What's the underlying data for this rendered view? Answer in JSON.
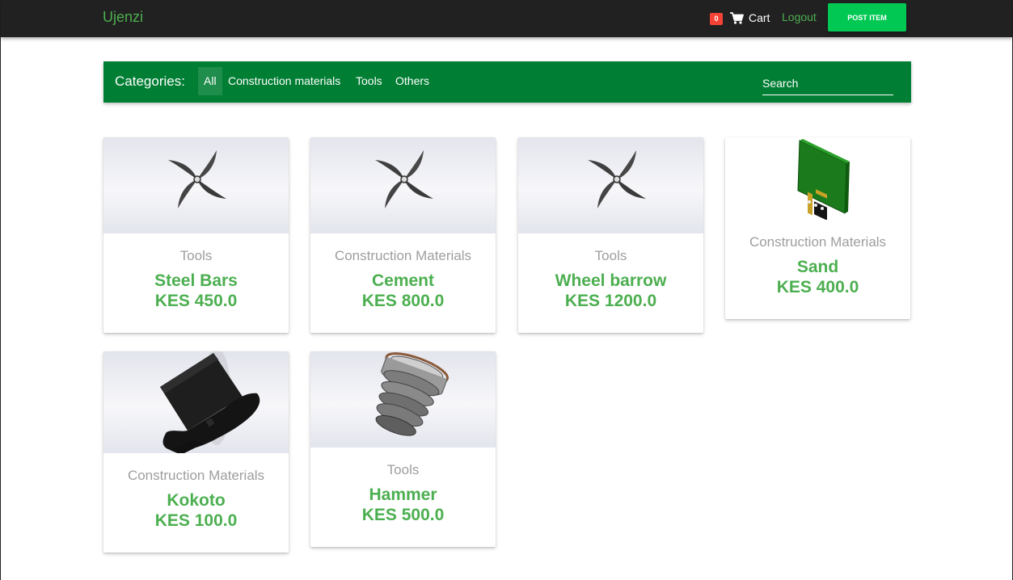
{
  "navbar": {
    "brand": "Ujenzi",
    "cart_count": "0",
    "cart_label": "Cart",
    "logout_label": "Logout",
    "post_item_label": "POST ITEM"
  },
  "categories": {
    "title": "Categories:",
    "items": [
      {
        "label": "All",
        "active": true
      },
      {
        "label": "Construction materials",
        "active": false
      },
      {
        "label": "Tools",
        "active": false
      },
      {
        "label": "Others",
        "active": false
      }
    ],
    "search_placeholder": "Search"
  },
  "products": [
    {
      "category": "Tools",
      "name": "Steel Bars",
      "price": "KES 450.0",
      "image": "propeller-icon"
    },
    {
      "category": "Construction Materials",
      "name": "Cement",
      "price": "KES 800.0",
      "image": "propeller-icon"
    },
    {
      "category": "Tools",
      "name": "Wheel barrow",
      "price": "KES 1200.0",
      "image": "propeller-icon"
    },
    {
      "category": "Construction Materials",
      "name": "Sand",
      "price": "KES 400.0",
      "image": "circuit-board-icon"
    },
    {
      "category": "Construction Materials",
      "name": "Kokoto",
      "price": "KES 100.0",
      "image": "top-hat-icon"
    },
    {
      "category": "Tools",
      "name": "Hammer",
      "price": "KES 500.0",
      "image": "bellows-icon"
    }
  ],
  "colors": {
    "navbar_bg": "#212121",
    "brand_green": "#4caf50",
    "category_bar": "#007e33",
    "post_button": "#00c853",
    "badge_red": "#f44336",
    "muted_text": "#9e9e9e"
  }
}
